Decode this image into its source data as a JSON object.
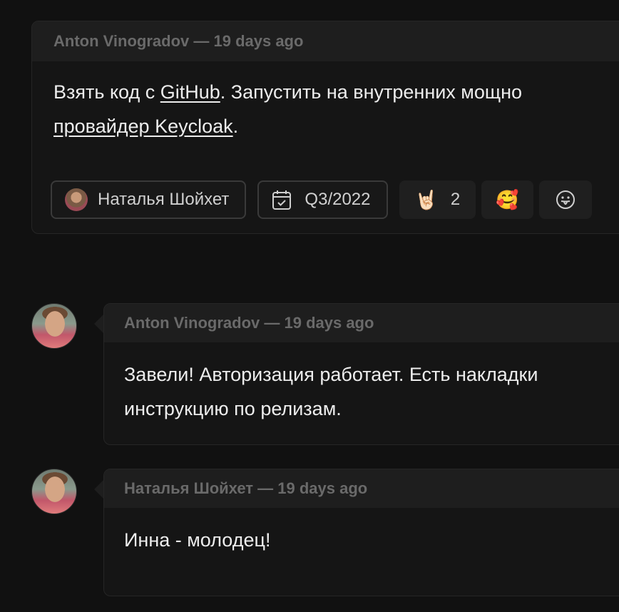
{
  "main_card": {
    "header": "Anton Vinogradov — 19 days ago",
    "body": {
      "line1_prefix": "Взять код с ",
      "line1_link": "GitHub",
      "line1_suffix": ". Запустить на внутренних мощно",
      "line2_link": "провайдер Keycloak",
      "line2_suffix": "."
    },
    "chips": {
      "assignee": "Наталья Шойхет",
      "due": "Q3/2022",
      "reaction1_emoji": "🤘🏻",
      "reaction1_count": "2",
      "reaction2_emoji": "🥰",
      "add_reaction_icon": "emoji-add-icon"
    }
  },
  "comments": [
    {
      "header": "Anton Vinogradov — 19 days ago",
      "line1": "Завели! Авторизация работает. Есть накладки",
      "line2": "инструкцию по релизам."
    },
    {
      "header": "Наталья Шойхет — 19 days ago",
      "line1": "Инна - молодец!"
    }
  ]
}
